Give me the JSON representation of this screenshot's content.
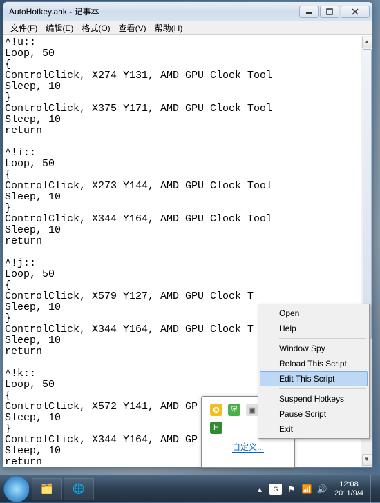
{
  "window": {
    "title": "AutoHotkey.ahk - 记事本"
  },
  "menu": [
    {
      "label": "文件(F)"
    },
    {
      "label": "编辑(E)"
    },
    {
      "label": "格式(O)"
    },
    {
      "label": "查看(V)"
    },
    {
      "label": "帮助(H)"
    }
  ],
  "editor_text": "^!u::\nLoop, 50\n{\nControlClick, X274 Y131, AMD GPU Clock Tool\nSleep, 10\n}\nControlClick, X375 Y171, AMD GPU Clock Tool\nSleep, 10\nreturn\n\n^!i::\nLoop, 50\n{\nControlClick, X273 Y144, AMD GPU Clock Tool\nSleep, 10\n}\nControlClick, X344 Y164, AMD GPU Clock Tool\nSleep, 10\nreturn\n\n^!j::\nLoop, 50\n{\nControlClick, X579 Y127, AMD GPU Clock T\nSleep, 10\n}\nControlClick, X344 Y164, AMD GPU Clock T\nSleep, 10\nreturn\n\n^!k::\nLoop, 50\n{\nControlClick, X572 Y141, AMD GP\nSleep, 10\n}\nControlClick, X344 Y164, AMD GP\nSleep, 10\nreturn",
  "context_menu": {
    "items": [
      {
        "label": "Open",
        "hl": false
      },
      {
        "label": "Help",
        "hl": false
      },
      {
        "sep": true
      },
      {
        "label": "Window Spy",
        "hl": false
      },
      {
        "label": "Reload This Script",
        "hl": false
      },
      {
        "label": "Edit This Script",
        "hl": true
      },
      {
        "sep": true
      },
      {
        "label": "Suspend Hotkeys",
        "hl": false
      },
      {
        "label": "Pause Script",
        "hl": false
      },
      {
        "label": "Exit",
        "hl": false
      }
    ]
  },
  "tray_popup": {
    "link_text": "自定义..."
  },
  "clock": {
    "time": "12:08",
    "date": "2011/9/4"
  }
}
